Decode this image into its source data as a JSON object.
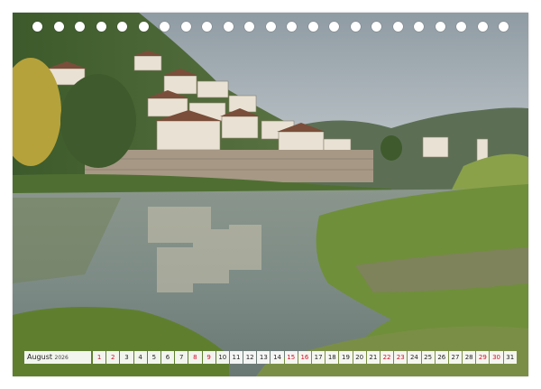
{
  "calendar": {
    "month": "August",
    "year": "2026",
    "days": [
      "1",
      "2",
      "3",
      "4",
      "5",
      "6",
      "7",
      "8",
      "9",
      "10",
      "11",
      "12",
      "13",
      "14",
      "15",
      "16",
      "17",
      "18",
      "19",
      "20",
      "21",
      "22",
      "23",
      "24",
      "25",
      "26",
      "27",
      "28",
      "29",
      "30",
      "31"
    ],
    "red_days": [
      "1",
      "2",
      "8",
      "9",
      "15",
      "16",
      "22",
      "23",
      "29",
      "30"
    ]
  },
  "colors": {
    "sky": "#b9c2c7",
    "water": "#7f8d88",
    "grass": "#6f8f3a",
    "holiday_red": "#d0102a"
  },
  "scene": {
    "icons": [
      "ring-binding-hole"
    ]
  }
}
